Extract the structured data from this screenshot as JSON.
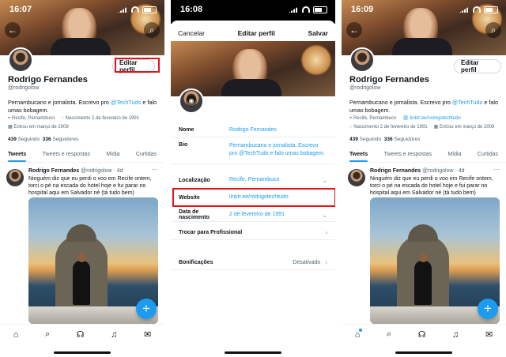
{
  "phone1": {
    "time": "16:07",
    "name": "Rodrigo Fernandes",
    "handle": "@rodrigolow",
    "edit_label": "Editar perfil",
    "bio_pre": "Pernambucano e jornalista. Escrevo pro ",
    "bio_mention": "@TechTudo",
    "bio_post": " e falo umas bobagem.",
    "location": "Recife, Pernambuco",
    "birth": "Nascimento 2 de fevereiro de 1991",
    "joined": "Entrou em março de 2009",
    "following_count": "439",
    "following_label": "Seguindo",
    "followers_count": "336",
    "followers_label": "Seguidores",
    "tabs": [
      "Tweets",
      "Tweets e respostas",
      "Mídia",
      "Curtidas"
    ],
    "tweet_name": "Rodrigo Fernandes",
    "tweet_meta": "@rodrigolow · 4d",
    "tweet_text": "Ninguém diz que eu perdi o voo em Recife ontem, torci o pé na escada do hotel hoje e fui parar no hospital aqui em Salvador né (tá tudo bem)",
    "highlight_color": "#e0141b"
  },
  "phone2": {
    "time": "16:08",
    "cancel": "Cancelar",
    "title": "Editar perfil",
    "save": "Salvar",
    "rows": {
      "name_k": "Nome",
      "name_v": "Rodrigo Fernandes",
      "bio_k": "Bio",
      "bio_v": "Pernambucano e jornalista. Escrevo pro @TechTudo e falo umas bobagem.",
      "loc_k": "Localização",
      "loc_v": "Recife, Pernambuco",
      "web_k": "Website",
      "web_v": "linktr.ee/rodrigotechtudo",
      "birth_k": "Data de nascimento",
      "birth_v": "2 de fevereiro de 1991",
      "pro": "Trocar para Profissional",
      "bonus_k": "Bonificações",
      "bonus_v": "Desativado"
    }
  },
  "phone3": {
    "time": "16:09",
    "name": "Rodrigo Fernandes",
    "handle": "@rodrigolow",
    "edit_label": "Editar perfil",
    "bio_pre": "Pernambucano e jornalista. Escrevo pro ",
    "bio_mention": "@TechTudo",
    "bio_post": " e falo umas bobagem.",
    "location": "Recife, Pernambuco",
    "website": "linktr.ee/rodrigotechtudo",
    "birth": "Nascimento 2 de fevereiro de 1991",
    "joined": "Entrou em março de 2009",
    "following_count": "439",
    "following_label": "Seguindo",
    "followers_count": "336",
    "followers_label": "Seguidores",
    "tabs": [
      "Tweets",
      "Tweets e respostas",
      "Mídia",
      "Curtidas"
    ],
    "tweet_name": "Rodrigo Fernandes",
    "tweet_meta": "@rodrigolow · 4d",
    "tweet_text": "Ninguém diz que eu perdi o voo em Recife ontem, torci o pé na escada do hotel hoje e fui parar no hospital aqui em Salvador né (tá tudo bem)"
  },
  "icons": {
    "back": "arrow-left-icon",
    "search": "search-icon",
    "home": "home-icon",
    "explore": "search-icon",
    "spaces": "spaces-icon",
    "notifications": "bell-icon",
    "messages": "mail-icon",
    "compose": "plus-icon",
    "camera": "camera-icon"
  },
  "accent": "#1d9bf0"
}
